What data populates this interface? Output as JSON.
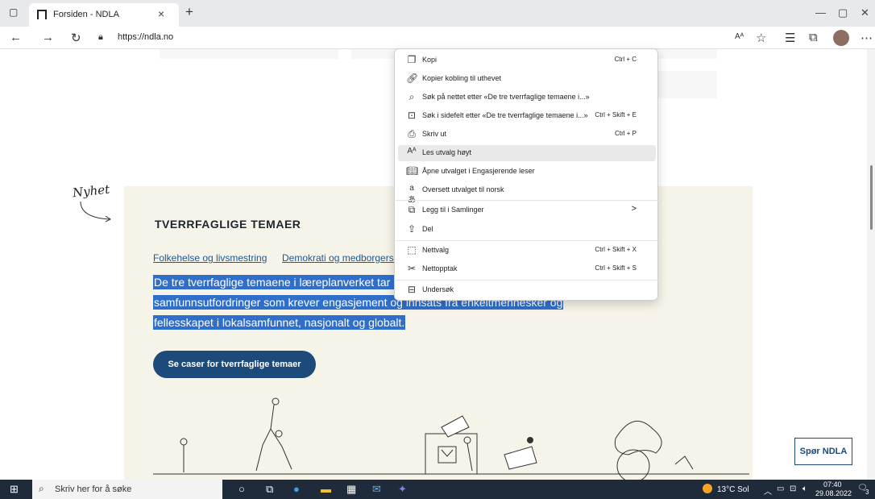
{
  "browser": {
    "tab_title": "Forsiden - NDLA",
    "tab_close": "×",
    "new_tab": "+",
    "url": "https://ndla.no",
    "window_buttons": [
      "—",
      "▢",
      "✕"
    ]
  },
  "page": {
    "nyhet_label": "Nyhet",
    "section_heading": "TVERRFAGLIGE TEMAER",
    "links": [
      "Folkehelse og livsmestring",
      "Demokrati og medborgerskap"
    ],
    "selected_text_lines": [
      "De tre tverrfaglige temaene i læreplanverket tar utgangspunkt i",
      "samfunnsutfordringer som krever engasjement og innsats fra enkeltmennesker og",
      "fellesskapet i lokalsamfunnet, nasjonalt og globalt."
    ],
    "cta_button": "Se caser for tverrfaglige temaer",
    "ask_button": "Spør NDLA"
  },
  "context_menu": {
    "items": [
      {
        "icon": "copy-icon",
        "label": "Kopi",
        "shortcut": "Ctrl + C"
      },
      {
        "icon": "link-copy-icon",
        "label": "Kopier kobling til uthevet",
        "shortcut": ""
      },
      {
        "icon": "search-icon",
        "label": "Søk på nettet etter «De tre tverrfaglige temaene i...»",
        "shortcut": ""
      },
      {
        "icon": "sidebar-search-icon",
        "label": "Søk i sidefelt etter «De tre tverrfaglige temaene i...»",
        "shortcut": "Ctrl + Skift + E"
      },
      {
        "icon": "print-icon",
        "label": "Skriv ut",
        "shortcut": "Ctrl + P"
      },
      {
        "icon": "read-aloud-icon",
        "label": "Les utvalg høyt",
        "shortcut": ""
      },
      {
        "icon": "immersive-reader-icon",
        "label": "Åpne utvalget i Engasjerende leser",
        "shortcut": ""
      },
      {
        "icon": "translate-icon",
        "label": "Oversett utvalget til norsk",
        "shortcut": ""
      },
      {
        "icon": "collections-icon",
        "label": "Legg til i Samlinger",
        "shortcut": ">"
      },
      {
        "icon": "share-icon",
        "label": "Del",
        "shortcut": ""
      },
      {
        "icon": "web-select-icon",
        "label": "Nettvalg",
        "shortcut": "Ctrl + Skift + X"
      },
      {
        "icon": "web-capture-icon",
        "label": "Nettopptak",
        "shortcut": "Ctrl + Skift + S"
      },
      {
        "icon": "inspect-icon",
        "label": "Undersøk",
        "shortcut": ""
      }
    ]
  },
  "taskbar": {
    "search_placeholder": "Skriv her for å søke",
    "weather": "13°C  Sol",
    "time": "07:40",
    "date": "29.08.2022",
    "notification_count": "3"
  }
}
